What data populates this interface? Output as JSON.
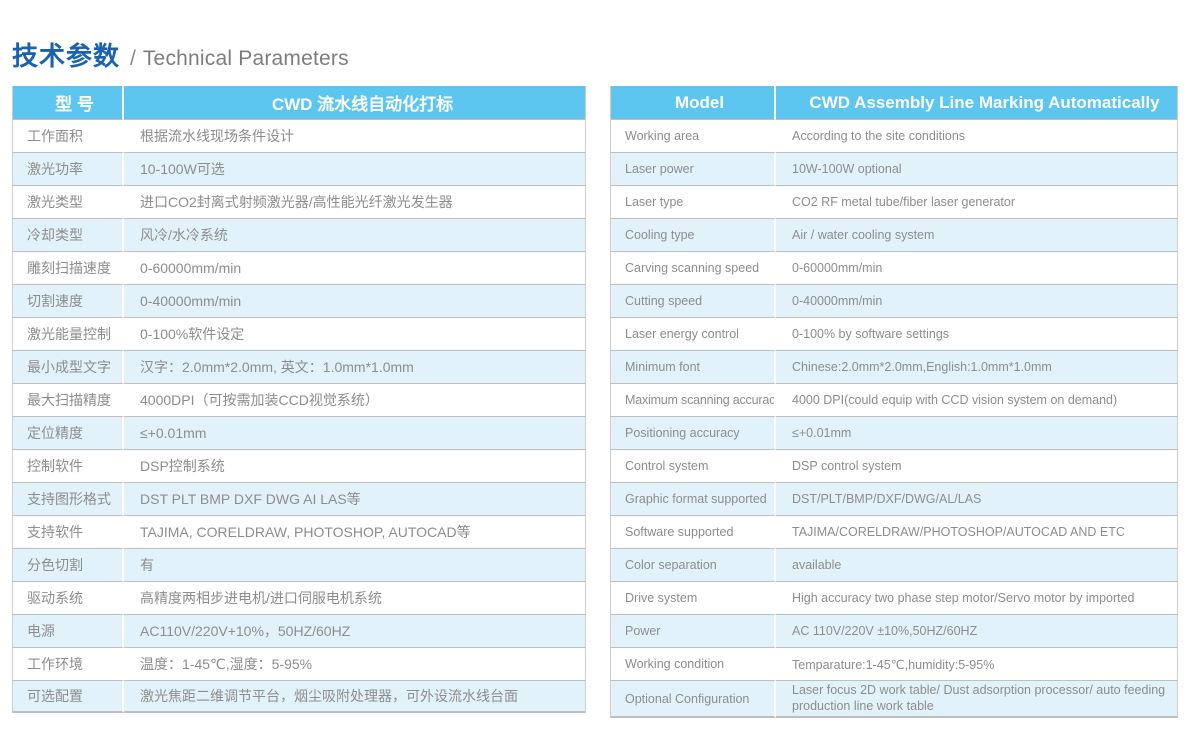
{
  "title": {
    "cn": "技术参数",
    "separator": "/",
    "en": "Technical Parameters"
  },
  "colors": {
    "header_bg": "#5cc6f0",
    "header_text": "#ffffff",
    "stripe_bg": "#e2f2fb",
    "row_bg": "#ffffff",
    "body_text": "#8d8d8d",
    "title_cn": "#1a62b0",
    "title_en": "#7d7d7d",
    "border": "#bfbfbf"
  },
  "table_cn": {
    "header": {
      "key": "型  号",
      "value": "CWD 流水线自动化打标"
    },
    "rows": [
      {
        "key": "工作面积",
        "value": "根据流水线现场条件设计"
      },
      {
        "key": "激光功率",
        "value": "10-100W可选"
      },
      {
        "key": "激光类型",
        "value": "进口CO2封离式射频激光器/高性能光纤激光发生器"
      },
      {
        "key": "冷却类型",
        "value": "风冷/水冷系统"
      },
      {
        "key": "雕刻扫描速度",
        "value": "0-60000mm/min"
      },
      {
        "key": "切割速度",
        "value": "0-40000mm/min"
      },
      {
        "key": "激光能量控制",
        "value": "0-100%软件设定"
      },
      {
        "key": "最小成型文字",
        "value": "汉字：2.0mm*2.0mm, 英文：1.0mm*1.0mm"
      },
      {
        "key": "最大扫描精度",
        "value": "4000DPI（可按需加装CCD视觉系统）"
      },
      {
        "key": "定位精度",
        "value": "≤+0.01mm"
      },
      {
        "key": "控制软件",
        "value": "DSP控制系统"
      },
      {
        "key": "支持图形格式",
        "value": "DST PLT BMP DXF DWG AI LAS等"
      },
      {
        "key": "支持软件",
        "value": "TAJIMA, CORELDRAW, PHOTOSHOP, AUTOCAD等"
      },
      {
        "key": "分色切割",
        "value": "有"
      },
      {
        "key": "驱动系统",
        "value": "高精度两相步进电机/进口伺服电机系统"
      },
      {
        "key": "电源",
        "value": "AC110V/220V+10%，50HZ/60HZ"
      },
      {
        "key": "工作环境",
        "value": "温度：1-45℃,湿度：5-95%"
      },
      {
        "key": "可选配置",
        "value": "激光焦距二维调节平台，烟尘吸附处理器，可外设流水线台面"
      }
    ]
  },
  "table_en": {
    "header": {
      "key": "Model",
      "value": "CWD Assembly Line Marking Automatically"
    },
    "rows": [
      {
        "key": "Working area",
        "value": "According to the site conditions"
      },
      {
        "key": "Laser power",
        "value": "10W-100W optional"
      },
      {
        "key": "Laser type",
        "value": "CO2 RF metal tube/fiber laser generator"
      },
      {
        "key": "Cooling type",
        "value": "Air / water cooling system"
      },
      {
        "key": "Carving scanning speed",
        "value": "0-60000mm/min"
      },
      {
        "key": "Cutting speed",
        "value": "0-40000mm/min"
      },
      {
        "key": "Laser energy control",
        "value": "0-100% by software settings"
      },
      {
        "key": "Minimum font",
        "value": "Chinese:2.0mm*2.0mm,English:1.0mm*1.0mm"
      },
      {
        "key": "Maximum scanning accuracy",
        "value": "4000 DPI(could equip with CCD vision system on demand)"
      },
      {
        "key": "Positioning accuracy",
        "value": "≤+0.01mm"
      },
      {
        "key": "Control system",
        "value": "DSP control system"
      },
      {
        "key": "Graphic format supported",
        "value": "DST/PLT/BMP/DXF/DWG/AL/LAS"
      },
      {
        "key": "Software supported",
        "value": "TAJIMA/CORELDRAW/PHOTOSHOP/AUTOCAD AND ETC"
      },
      {
        "key": "Color separation",
        "value": "available"
      },
      {
        "key": "Drive system",
        "value": "High accuracy two phase step motor/Servo motor by imported"
      },
      {
        "key": "Power",
        "value": "AC 110V/220V ±10%,50HZ/60HZ"
      },
      {
        "key": "Working condition",
        "value": "Temparature:1-45℃,humidity:5-95%"
      },
      {
        "key": "Optional Configuration",
        "value": "Laser focus 2D work table/ Dust adsorption processor/ auto feeding production line work table"
      }
    ]
  }
}
